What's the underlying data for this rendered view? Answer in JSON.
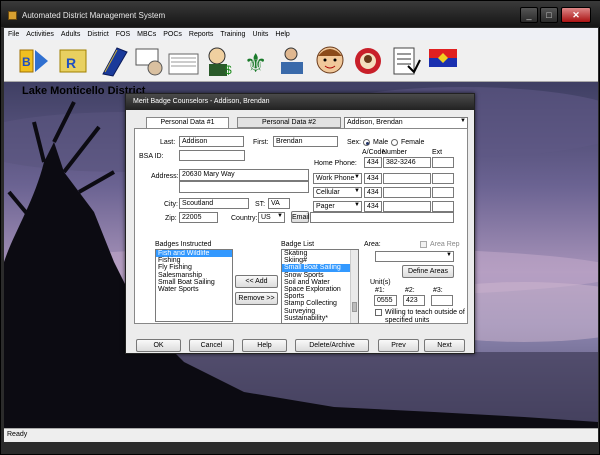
{
  "window": {
    "title": "Automated District Management System",
    "minimize": "_",
    "maximize": "□",
    "close": "✕"
  },
  "menu": [
    "File",
    "Activities",
    "Adults",
    "District",
    "FOS",
    "MBCs",
    "POCs",
    "Reports",
    "Training",
    "Units",
    "Help"
  ],
  "toolbar": [
    "adults-tool",
    "eagle-reports-tool",
    "book-tool",
    "handshake-tool",
    "meeting-tool",
    "money-fleur-tool",
    "fleur-de-lis-tool",
    "desk-tool",
    "boy-face-tool",
    "bear-tool",
    "checklist-tool",
    "flag-tool"
  ],
  "desktop": {
    "title": "Lake Monticello District"
  },
  "status": {
    "text": "Ready"
  },
  "dialog": {
    "title": "Merit Badge Counselors - Addison,   Brendan",
    "tabs": [
      "Personal Data #1",
      "Personal Data #2"
    ],
    "counselor_select": "Addison,   Brendan",
    "personal": {
      "last_label": "Last:",
      "last": "Addison",
      "first_label": "First:",
      "first": "Brendan",
      "sex_label": "Sex:",
      "male": "Male",
      "female": "Female",
      "sex": "Male",
      "bsa_label": "BSA ID:",
      "bsa_id": "",
      "address_label": "Address:",
      "address": "20630 Mary Way",
      "city_label": "City:",
      "city": "Scoutland",
      "st_label": "ST:",
      "st": "VA",
      "zip_label": "Zip:",
      "zip": "22005",
      "country_label": "Country:",
      "country": "US",
      "email_button": "Email:",
      "email": ""
    },
    "phones": {
      "area_header": "A/Code",
      "number_header": "Number",
      "ext_header": "Ext",
      "home_label": "Home Phone:",
      "rows": [
        {
          "type": "",
          "area": "434",
          "number": "382-3246",
          "ext": ""
        },
        {
          "type": "Work Phone",
          "area": "434",
          "number": "",
          "ext": ""
        },
        {
          "type": "Cellular",
          "area": "434",
          "number": "",
          "ext": ""
        },
        {
          "type": "Pager",
          "area": "434",
          "number": "",
          "ext": ""
        }
      ]
    },
    "badges_instructed": {
      "label": "Badges Instructed",
      "items": [
        "Fish and Wildlife",
        "Fishing",
        "Fly Fishing",
        "Salesmanship",
        "Small Boat Sailing",
        "Water Sports"
      ],
      "selected": 0
    },
    "add_button": "<< Add",
    "remove_button": "Remove >>",
    "badge_list": {
      "label": "Badge List",
      "items": [
        "Skating",
        "Skiing#",
        "Small Boat Sailing",
        "Snow Sports",
        "Soil and Water",
        "Space Exploration",
        "Sports",
        "Stamp Collecting",
        "Surveying",
        "Sustainability*"
      ],
      "selected": 2
    },
    "area": {
      "label": "Area:",
      "rep_label": "Area Rep",
      "value": "",
      "define_button": "Define Areas"
    },
    "units": {
      "label": "Unit(s)",
      "headers": [
        "#1:",
        "#2:",
        "#3:"
      ],
      "values": [
        "0555",
        "423",
        ""
      ],
      "willing_label": "Willing to teach outside of specified units"
    },
    "buttons": [
      "OK",
      "Cancel",
      "Help",
      "Delete/Archive",
      "Prev",
      "Next"
    ]
  },
  "colors": {
    "selection": "#3399ff",
    "dialog_bg": "#ececec",
    "titlebar": "#222222"
  }
}
